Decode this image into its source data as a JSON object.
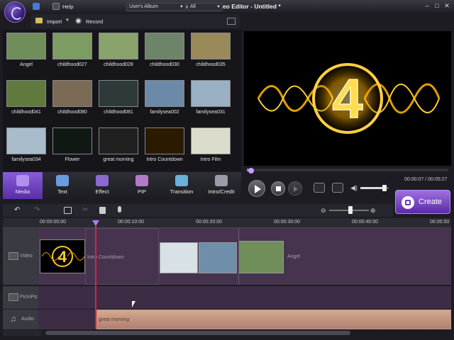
{
  "app": {
    "title": "Wondershare Video Editor - Untitled *",
    "help": "Help"
  },
  "toolbar": {
    "import": "Import",
    "record": "Record",
    "album_select": "User's Album",
    "filter_select": "All"
  },
  "media": [
    {
      "label": "Angel",
      "color": "#6f8e5a"
    },
    {
      "label": "childhood027",
      "color": "#7c9c62"
    },
    {
      "label": "childhood028",
      "color": "#8aa26c"
    },
    {
      "label": "childhood030",
      "color": "#6e8468"
    },
    {
      "label": "childhood035",
      "color": "#9a8a5a"
    },
    {
      "label": "childhood041",
      "color": "#5f7a3c"
    },
    {
      "label": "childhood080",
      "color": "#7b6a56"
    },
    {
      "label": "childhood081",
      "color": "#2e3a3a"
    },
    {
      "label": "familysea002",
      "color": "#6c8aa8"
    },
    {
      "label": "familysea031",
      "color": "#9ab0c4"
    },
    {
      "label": "familysea034",
      "color": "#a8bccc"
    },
    {
      "label": "Flower",
      "color": "#101814"
    },
    {
      "label": "great morning",
      "color": "#202020"
    },
    {
      "label": "Intro Countdown",
      "color": "#2a1a00"
    },
    {
      "label": "Intro Film",
      "color": "#dcdccc"
    }
  ],
  "tabs": [
    {
      "label": "Media",
      "color": "#b090ee"
    },
    {
      "label": "Text",
      "color": "#6a9cdc"
    },
    {
      "label": "Effect",
      "color": "#8a6ad0"
    },
    {
      "label": "PIP",
      "color": "#b07ac8"
    },
    {
      "label": "Transition",
      "color": "#6ab0d8"
    },
    {
      "label": "Intro/Credit",
      "color": "#9a9aa8"
    }
  ],
  "preview": {
    "countdown": "4",
    "time_current": "00:00:07",
    "time_total": "00:05:27",
    "time_sep": " / ",
    "volume": 0.85,
    "progress": 0.02
  },
  "create": {
    "label": "Create"
  },
  "ruler": [
    "00:00:00:00",
    "00:00:10:00",
    "00:00:20:00",
    "00:00:30:00",
    "00:00:40:00",
    "00:00:50"
  ],
  "tracks": {
    "video": "Video",
    "pip": "PicInPic",
    "audio": "Audio"
  },
  "clips": {
    "intro": "Intro Countdown",
    "angel": "Angel",
    "audio": "great morning"
  },
  "zoom": 0.53
}
